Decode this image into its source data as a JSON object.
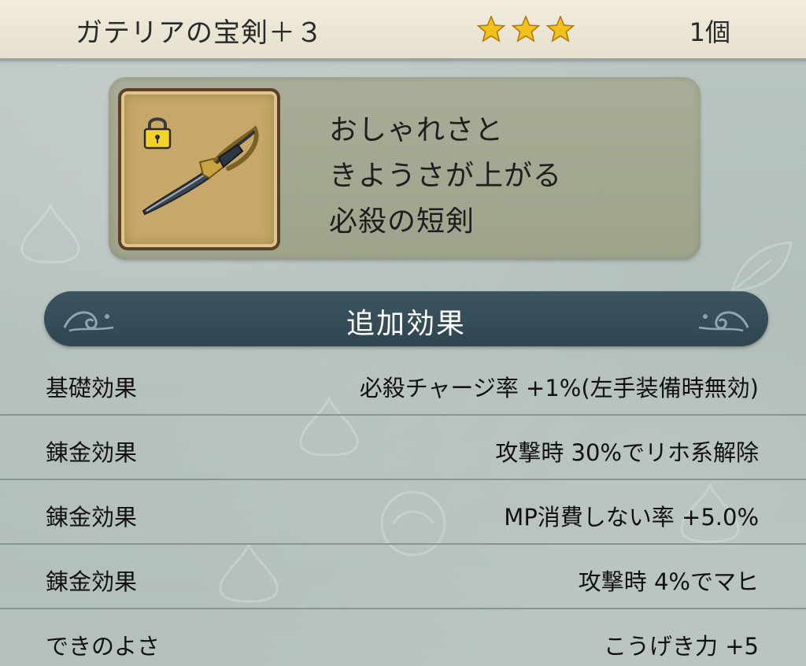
{
  "header": {
    "item_name": "ガテリアの宝剣＋３",
    "count": "1個",
    "stars": 3,
    "star_icon": "star-icon"
  },
  "item": {
    "icon": "sword-icon",
    "locked_icon": "lock-icon",
    "description_lines": [
      "おしゃれさと",
      "きようさが上がる",
      "必殺の短剣"
    ]
  },
  "section": {
    "title": "追加効果"
  },
  "effects": [
    {
      "label": "基礎効果",
      "value": "必殺チャージ率 +1%(左手装備時無効)"
    },
    {
      "label": "錬金効果",
      "value": "攻撃時 30%でリホ系解除"
    },
    {
      "label": "錬金効果",
      "value": "MP消費しない率 +5.0%"
    },
    {
      "label": "錬金効果",
      "value": "攻撃時 4%でマヒ"
    },
    {
      "label": "できのよさ",
      "value": "こうげき力 +5"
    }
  ],
  "colors": {
    "header_bg": "#ece6d4",
    "panel_bg": "#a5a993",
    "banner_bg": "#35505a",
    "star": "#f2c21a",
    "icon_bg": "#c7a86a",
    "text": "#1e1e1e"
  }
}
